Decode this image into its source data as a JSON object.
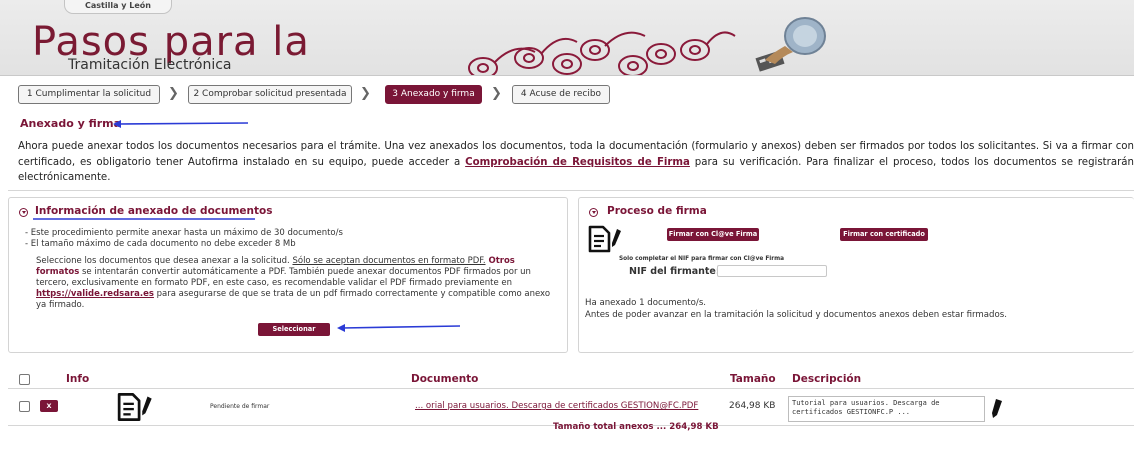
{
  "header": {
    "region": "Castilla y León",
    "title": "Pasos para la",
    "subtitle": "Tramitación Electrónica"
  },
  "steps": [
    {
      "label": "1 Cumplimentar la solicitud",
      "active": false
    },
    {
      "label": "2 Comprobar solicitud presentada",
      "active": false
    },
    {
      "label": "3 Anexado y firma",
      "active": true
    },
    {
      "label": "4 Acuse de recibo",
      "active": false
    }
  ],
  "page": {
    "heading": "Anexado y firma",
    "intro_1": "Ahora puede anexar todos los documentos necesarios para el trámite. Una vez anexados los documentos, toda la documentación (formulario y anexos) deben ser firmados por todos los solicitantes. Si va a firmar con certificado, es obligatorio tener Autofirma instalado en su equipo, puede acceder a ",
    "intro_link": "Comprobación de Requisitos de Firma",
    "intro_2": " para su verificación. Para finalizar el proceso, todos los documentos se registrarán electrónicamente."
  },
  "left_panel": {
    "title": "Información de anexado de documentos",
    "rules": [
      "- Este procedimiento permite anexar hasta un máximo de 30 documento/s",
      "- El tamaño máximo de cada documento no debe exceder 8 Mb"
    ],
    "desc_1": "Seleccione los documentos que desea anexar a la solicitud. ",
    "desc_underlined": "Sólo se aceptan documentos en formato PDF.",
    "desc_bold": " Otros formatos",
    "desc_2": " se intentarán convertir automáticamente a PDF. También puede anexar documentos PDF firmados por un tercero, exclusivamente en formato PDF, en este caso, es recomendable validar el PDF firmado previamente en ",
    "desc_link": "https://valide.redsara.es",
    "desc_3": " para asegurarse de que se trata de un pdf firmado correctamente y compatible como anexo ya firmado.",
    "select_button": "Seleccionar"
  },
  "right_panel": {
    "title": "Proceso de firma",
    "btn_clave": "Firmar con Cl@ve Firma",
    "btn_cert": "Firmar con certificado",
    "note": "Solo completar el NIF para firmar con Cl@ve Firma",
    "nif_label": "NIF del firmante:",
    "nif_value": "",
    "status_1": "Ha anexado 1  documento/s.",
    "status_2": "Antes de poder avanzar en la tramitación la solicitud y documentos anexos deben estar firmados."
  },
  "table": {
    "headers": {
      "info": "Info",
      "document": "Documento",
      "size": "Tamaño",
      "description": "Descripción"
    },
    "rows": [
      {
        "delete_label": "X",
        "status": "Pendiente de firmar",
        "document": "... orial para usuarios. Descarga de certificados GESTION@FC.PDF",
        "size": "264,98 KB",
        "description": "Tutorial para usuarios. Descarga de certificados GESTIONFC.P ..."
      }
    ],
    "total": "Tamaño total anexos ... 264,98 KB"
  },
  "colors": {
    "brand": "#7a1537",
    "annotation_arrow": "#2b3bd6"
  }
}
